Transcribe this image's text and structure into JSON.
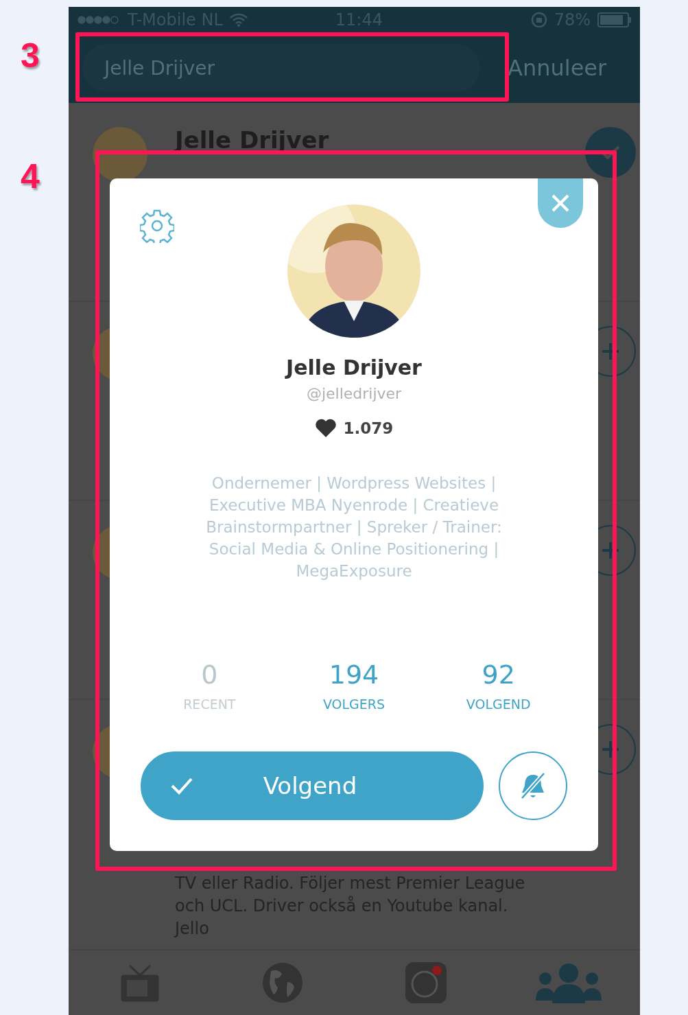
{
  "annotations": [
    {
      "label": "3"
    },
    {
      "label": "4"
    }
  ],
  "status_bar": {
    "carrier": "T-Mobile NL",
    "time": "11:44",
    "battery": "78%"
  },
  "search": {
    "value": "Jelle Drijver",
    "cancel": "Annuleer"
  },
  "results": [
    {
      "name": "Jelle Drijver",
      "following": true
    },
    {
      "following": false
    },
    {
      "following": false
    },
    {
      "following": false,
      "bio_lines": [
        "TV eller Radio. Följer mest Premier League",
        "och UCL. Driver också en Youtube kanal.",
        "Jello"
      ]
    }
  ],
  "profile": {
    "name": "Jelle Drijver",
    "handle": "@jelledrijver",
    "likes": "1.079",
    "bio": "Ondernemer | Wordpress Websites | Executive MBA Nyenrode | Creatieve Brainstormpartner | Spreker / Trainer: Social Media & Online Positionering | MegaExposure",
    "stats": [
      {
        "value": "0",
        "label": "RECENT",
        "active": false
      },
      {
        "value": "194",
        "label": "VOLGERS",
        "active": true
      },
      {
        "value": "92",
        "label": "VOLGEND",
        "active": true
      }
    ],
    "follow_button": {
      "label": "Volgend",
      "following": true
    },
    "notifications_muted": true
  },
  "tabs": [
    {
      "kind": "tv",
      "selected": false
    },
    {
      "kind": "globe",
      "selected": false
    },
    {
      "kind": "camera",
      "selected": false
    },
    {
      "kind": "people",
      "selected": true
    }
  ]
}
